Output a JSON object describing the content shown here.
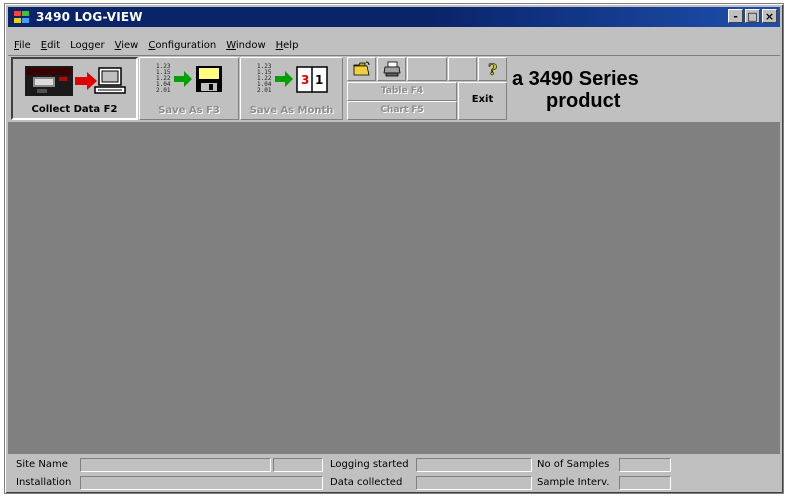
{
  "window": {
    "title": "3490 LOG-VIEW",
    "controls": {
      "minimize": "-",
      "maximize": "□",
      "close": "×"
    }
  },
  "menu": [
    {
      "label": "File",
      "accel": "F"
    },
    {
      "label": "Edit",
      "accel": "E"
    },
    {
      "label": "Logger",
      "accel": "g"
    },
    {
      "label": "View",
      "accel": "V"
    },
    {
      "label": "Configuration",
      "accel": "C"
    },
    {
      "label": "Window",
      "accel": "W"
    },
    {
      "label": "Help",
      "accel": "H"
    }
  ],
  "toolbar": {
    "collect_data": "Collect Data  F2",
    "save_as": "Save As  F3",
    "save_as_month": "Save As Month",
    "table": "Table F4",
    "chart": "Chart F5",
    "exit": "Exit",
    "icons": [
      "logger-to-computer-icon",
      "save-disk-icon",
      "save-month-icon",
      "open-folder-icon",
      "printer-icon",
      "help-icon"
    ]
  },
  "brand": {
    "line1": "a 3490 Series",
    "line2": "product"
  },
  "status": {
    "site_name": "Site Name",
    "installation": "Installation",
    "logging_started": "Logging started",
    "data_collected": "Data collected",
    "no_of_samples": "No of Samples",
    "sample_interv": "Sample Interv."
  },
  "colors": {
    "titlebar": "#0a246a",
    "workspace": "#808080",
    "face": "#c0c0c0",
    "arrow_green": "#00a000",
    "arrow_red": "#e00000"
  }
}
